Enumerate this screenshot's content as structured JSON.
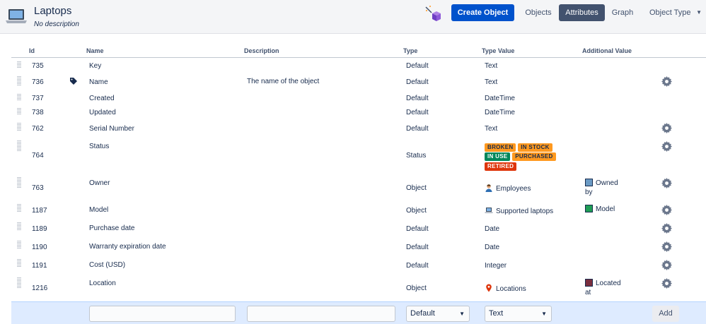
{
  "header": {
    "title": "Laptops",
    "description": "No description",
    "create_button": "Create Object",
    "nav": {
      "objects": "Objects",
      "attributes": "Attributes",
      "graph": "Graph",
      "object_type": "Object Type"
    }
  },
  "table": {
    "columns": {
      "id": "Id",
      "name": "Name",
      "description": "Description",
      "type": "Type",
      "type_value": "Type Value",
      "additional_value": "Additional Value"
    },
    "rows": {
      "r735": {
        "id": "735",
        "name": "Key",
        "description": "",
        "type": "Default",
        "type_value": "Text"
      },
      "r736": {
        "id": "736",
        "name": "Name",
        "description": "The name of the object",
        "type": "Default",
        "type_value": "Text"
      },
      "r737": {
        "id": "737",
        "name": "Created",
        "description": "",
        "type": "Default",
        "type_value": "DateTime"
      },
      "r738": {
        "id": "738",
        "name": "Updated",
        "description": "",
        "type": "Default",
        "type_value": "DateTime"
      },
      "r762": {
        "id": "762",
        "name": "Serial Number",
        "description": "",
        "type": "Default",
        "type_value": "Text"
      },
      "r764": {
        "id": "764",
        "name": "Status",
        "description": "",
        "type": "Status",
        "statuses": {
          "broken": "BROKEN",
          "in_stock": "IN STOCK",
          "in_use": "IN USE",
          "purchased": "PURCHASED",
          "retired": "RETIRED"
        }
      },
      "r763": {
        "id": "763",
        "name": "Owner",
        "description": "",
        "type": "Object",
        "type_value": "Employees",
        "additional_line1": "Owned",
        "additional_line2": "by",
        "swatch_color": "#6b9ac4"
      },
      "r1187": {
        "id": "1187",
        "name": "Model",
        "description": "",
        "type": "Object",
        "type_value": "Supported laptops",
        "additional_line1": "Model",
        "swatch_color": "#1f9d55"
      },
      "r1189": {
        "id": "1189",
        "name": "Purchase date",
        "description": "",
        "type": "Default",
        "type_value": "Date"
      },
      "r1190": {
        "id": "1190",
        "name": "Warranty expiration date",
        "description": "",
        "type": "Default",
        "type_value": "Date"
      },
      "r1191": {
        "id": "1191",
        "name": "Cost (USD)",
        "description": "",
        "type": "Default",
        "type_value": "Integer"
      },
      "r1216": {
        "id": "1216",
        "name": "Location",
        "description": "",
        "type": "Object",
        "type_value": "Locations",
        "additional_line1": "Located",
        "additional_line2": "at",
        "swatch_color": "#7a2e3e"
      }
    }
  },
  "add_row": {
    "name_value": "",
    "description_value": "",
    "type_selected": "Default",
    "type_value_selected": "Text",
    "add_button": "Add"
  },
  "colors": {
    "primary": "#0052cc",
    "nav_active": "#42526e",
    "status_orange": "#ff991f",
    "status_green": "#00875a",
    "status_red": "#de350b"
  },
  "icons": {
    "object_type": "laptop-icon",
    "create_helper": "magic-wand-icon",
    "label_attribute": "tag-icon",
    "configure": "gear-icon",
    "employees": "person-icon",
    "supported_laptops": "laptop-icon",
    "locations": "map-pin-icon"
  }
}
